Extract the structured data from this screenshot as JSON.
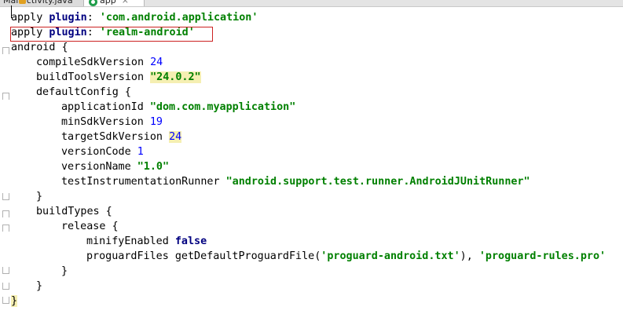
{
  "tabs": [
    {
      "label": "MainActivity.java",
      "visible_label": "Mai...ctivity.java",
      "icon": "java-class-icon",
      "active": false
    },
    {
      "label": "app",
      "icon": "gradle-icon",
      "active": true,
      "close": "×"
    }
  ],
  "editor": {
    "lines": [
      {
        "indent": 0,
        "parts": [
          {
            "t": "apply ",
            "c": "plain"
          },
          {
            "t": "plugin",
            "c": "kw"
          },
          {
            "t": ": ",
            "c": "plain"
          },
          {
            "t": "'com.android.application'",
            "c": "str"
          }
        ]
      },
      {
        "indent": 0,
        "parts": [
          {
            "t": "apply ",
            "c": "plain"
          },
          {
            "t": "plugin",
            "c": "kw"
          },
          {
            "t": ": ",
            "c": "plain"
          },
          {
            "t": "'realm-android'",
            "c": "str"
          }
        ]
      },
      {
        "indent": 0,
        "parts": [
          {
            "t": "android {",
            "c": "plain"
          }
        ]
      },
      {
        "indent": 1,
        "parts": [
          {
            "t": "compileSdkVersion ",
            "c": "plain"
          },
          {
            "t": "24",
            "c": "num"
          }
        ]
      },
      {
        "indent": 1,
        "parts": [
          {
            "t": "buildToolsVersion ",
            "c": "plain"
          },
          {
            "t": "\"24.0.2\"",
            "c": "str hl-num"
          }
        ]
      },
      {
        "indent": 1,
        "parts": [
          {
            "t": "defaultConfig {",
            "c": "plain"
          }
        ]
      },
      {
        "indent": 2,
        "parts": [
          {
            "t": "applicationId ",
            "c": "plain"
          },
          {
            "t": "\"dom.com.myapplication\"",
            "c": "str"
          }
        ]
      },
      {
        "indent": 2,
        "parts": [
          {
            "t": "minSdkVersion ",
            "c": "plain"
          },
          {
            "t": "19",
            "c": "num"
          }
        ]
      },
      {
        "indent": 2,
        "parts": [
          {
            "t": "targetSdkVersion ",
            "c": "plain"
          },
          {
            "t": "24",
            "c": "num hl-num"
          }
        ]
      },
      {
        "indent": 2,
        "parts": [
          {
            "t": "versionCode ",
            "c": "plain"
          },
          {
            "t": "1",
            "c": "num"
          }
        ]
      },
      {
        "indent": 2,
        "parts": [
          {
            "t": "versionName ",
            "c": "plain"
          },
          {
            "t": "\"1.0\"",
            "c": "str"
          }
        ]
      },
      {
        "indent": 2,
        "parts": [
          {
            "t": "testInstrumentationRunner ",
            "c": "plain"
          },
          {
            "t": "\"android.support.test.runner.AndroidJUnitRunner\"",
            "c": "str"
          }
        ]
      },
      {
        "indent": 1,
        "parts": [
          {
            "t": "}",
            "c": "plain"
          }
        ]
      },
      {
        "indent": 1,
        "parts": [
          {
            "t": "buildTypes {",
            "c": "plain"
          }
        ]
      },
      {
        "indent": 2,
        "parts": [
          {
            "t": "release {",
            "c": "plain"
          }
        ]
      },
      {
        "indent": 3,
        "parts": [
          {
            "t": "minifyEnabled ",
            "c": "plain"
          },
          {
            "t": "false",
            "c": "bool"
          }
        ]
      },
      {
        "indent": 3,
        "parts": [
          {
            "t": "proguardFiles getDefaultProguardFile(",
            "c": "plain"
          },
          {
            "t": "'proguard-android.txt'",
            "c": "str"
          },
          {
            "t": "), ",
            "c": "plain"
          },
          {
            "t": "'proguard-rules.pro'",
            "c": "str"
          }
        ]
      },
      {
        "indent": 2,
        "parts": [
          {
            "t": "}",
            "c": "plain"
          }
        ]
      },
      {
        "indent": 1,
        "parts": [
          {
            "t": "}",
            "c": "plain"
          }
        ]
      },
      {
        "indent": 0,
        "parts": [
          {
            "t": "}",
            "c": "plain hl-brace"
          }
        ]
      }
    ]
  },
  "highlight": {
    "line_index": 1,
    "color": "#cc2222"
  },
  "colors": {
    "keyword": "#000080",
    "string": "#008000",
    "number": "#0000ff"
  }
}
